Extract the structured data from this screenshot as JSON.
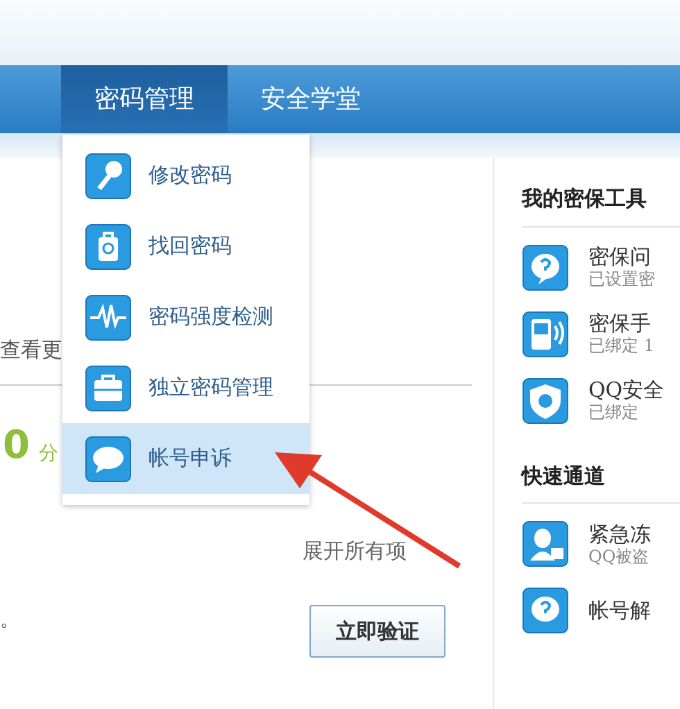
{
  "nav": {
    "tabs": [
      {
        "label": "密码管理",
        "selected": true
      },
      {
        "label": "安全学堂",
        "selected": false
      }
    ]
  },
  "dropdown": {
    "items": [
      {
        "label": "修改密码",
        "selected": false
      },
      {
        "label": "找回密码",
        "selected": false
      },
      {
        "label": "密码强度检测",
        "selected": false
      },
      {
        "label": "独立密码管理",
        "selected": false
      },
      {
        "label": "帐号申诉",
        "selected": true
      }
    ]
  },
  "main": {
    "more_link": "查看更",
    "score": "0",
    "score_unit": "分",
    "expand_all": "展开所有项",
    "note": "。",
    "verify_button": "立即验证"
  },
  "sidebar": {
    "sections": [
      {
        "title": "我的密保工具",
        "items": [
          {
            "title": "密保问",
            "subtitle": "已设置密"
          },
          {
            "title": "密保手",
            "subtitle": "已绑定 1"
          },
          {
            "title": "QQ安全",
            "subtitle": "已绑定"
          }
        ]
      },
      {
        "title": "快速通道",
        "items": [
          {
            "title": "紧急冻",
            "subtitle": "QQ被盗"
          },
          {
            "title": "帐号解"
          }
        ]
      }
    ]
  }
}
